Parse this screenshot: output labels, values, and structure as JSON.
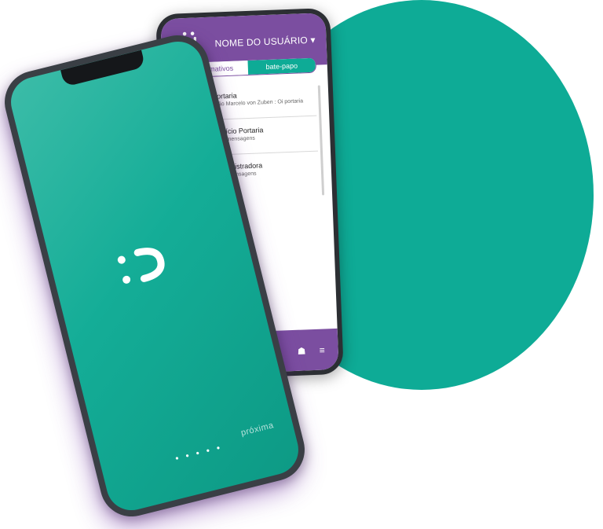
{
  "background": {
    "circle_color": "#0eab96"
  },
  "back_phone": {
    "header": {
      "logo_icon": "smile-logo-icon",
      "user_name": "NOME DO USUÁRIO",
      "dropdown_icon": "caret-down-icon",
      "color": "#7b4ea0"
    },
    "tabs": [
      {
        "label": "informativos",
        "active": false
      },
      {
        "label": "bate-papo",
        "active": true
      }
    ],
    "chats": [
      {
        "title": "Portaria",
        "subtitle": "João Marcelo von Zuben : Oi portaria"
      },
      {
        "title": "Edifício Portaria",
        "subtitle": "Sem mensagens"
      },
      {
        "title": "Administradora",
        "subtitle": "Sem mensagens"
      }
    ],
    "footer": {
      "icons": [
        "chat-icon",
        "people-icon",
        "menu-icon"
      ]
    }
  },
  "front_phone": {
    "logo_icon": "smile-logo-icon",
    "brand_text": "próxima",
    "dots": "• • • • •",
    "screen_color": "#14ad97"
  }
}
